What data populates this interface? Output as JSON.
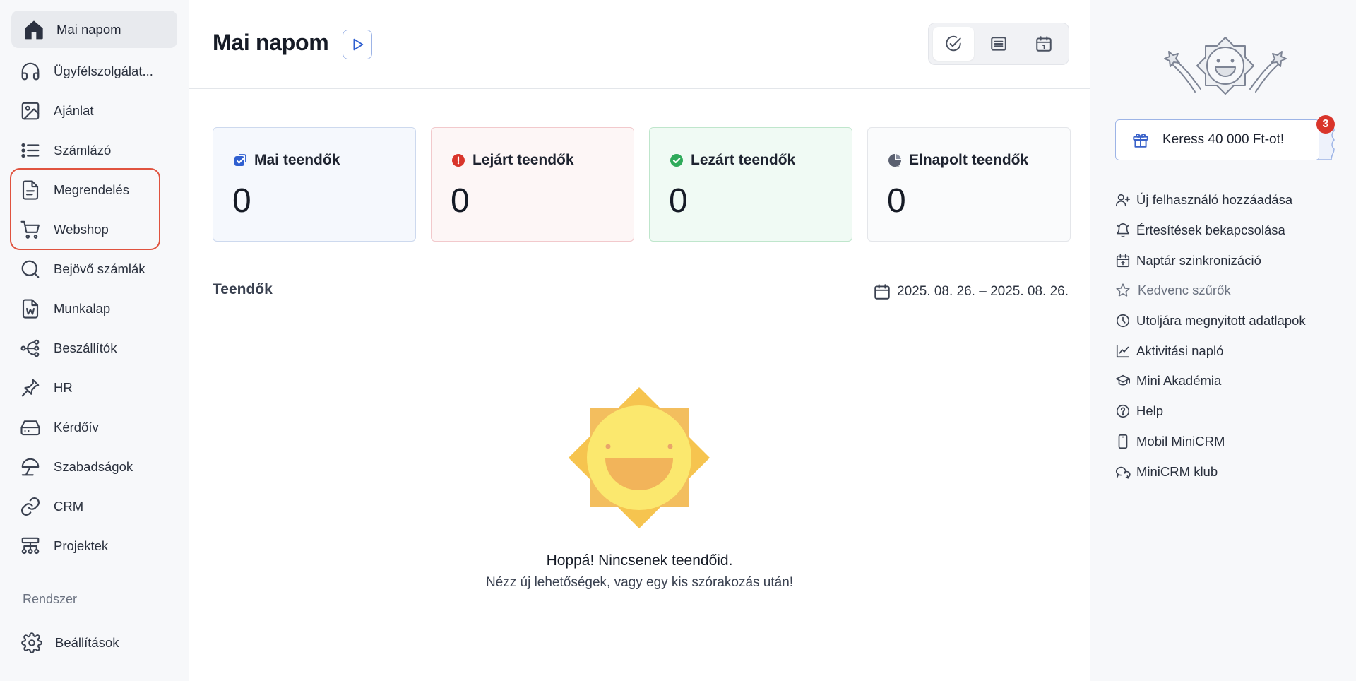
{
  "sidebar": {
    "home": {
      "label": "Mai napom",
      "icon": "home-icon"
    },
    "items": [
      {
        "label": "Ügyfélszolgálat...",
        "icon": "headphones-icon"
      },
      {
        "label": "Ajánlat",
        "icon": "image-icon"
      },
      {
        "label": "Számlázó",
        "icon": "list-icon"
      },
      {
        "label": "Megrendelés",
        "icon": "document-icon"
      },
      {
        "label": "Webshop",
        "icon": "cart-icon"
      },
      {
        "label": "Bejövő számlák",
        "icon": "magnifier-icon"
      },
      {
        "label": "Munkalap",
        "icon": "word-file-icon"
      },
      {
        "label": "Beszállítók",
        "icon": "branch-icon"
      },
      {
        "label": "HR",
        "icon": "pin-icon"
      },
      {
        "label": "Kérdőív",
        "icon": "drive-icon"
      },
      {
        "label": "Szabadságok",
        "icon": "umbrella-icon"
      },
      {
        "label": "CRM",
        "icon": "link-icon"
      },
      {
        "label": "Projektek",
        "icon": "hierarchy-icon"
      }
    ],
    "section_label": "Rendszer",
    "settings": {
      "label": "Beállítások",
      "icon": "gear-icon"
    },
    "highlight_color": "#e0533f"
  },
  "main": {
    "title": "Mai napom",
    "view_toggle": [
      "check-circle-icon",
      "list-view-icon",
      "calendar-icon"
    ],
    "stats": [
      {
        "label": "Mai teendők",
        "value": "0",
        "icon": "checkbox-icon",
        "color": "#2f5fd0"
      },
      {
        "label": "Lejárt teendők",
        "value": "0",
        "icon": "alert-icon",
        "color": "#d9352b"
      },
      {
        "label": "Lezárt teendők",
        "value": "0",
        "icon": "check-icon",
        "color": "#2faa5a"
      },
      {
        "label": "Elnapolt teendők",
        "value": "0",
        "icon": "snooze-icon",
        "color": "#5a6070"
      }
    ],
    "tasks_title": "Teendők",
    "date_range": "2025. 08. 26. – 2025. 08. 26.",
    "empty_title": "Hoppá! Nincsenek teendőid.",
    "empty_subtitle": "Nézz új lehetőségek, vagy egy kis szórakozás után!"
  },
  "right": {
    "gift_label": "Keress 40 000 Ft-ot!",
    "badge_count": "3",
    "quick_links": [
      {
        "label": "Új felhasználó hozzáadása",
        "icon": "user-plus-icon"
      },
      {
        "label": "Értesítések bekapcsolása",
        "icon": "bell-icon"
      },
      {
        "label": "Naptár szinkronizáció",
        "icon": "calendar-sync-icon"
      },
      {
        "label": "Kedvenc szűrők",
        "icon": "star-icon"
      },
      {
        "label": "Utoljára megnyitott adatlapok",
        "icon": "clock-icon"
      },
      {
        "label": "Aktivitási napló",
        "icon": "chart-line-icon"
      },
      {
        "label": "Mini Akadémia",
        "icon": "graduation-cap-icon"
      },
      {
        "label": "Help",
        "icon": "help-circle-icon"
      },
      {
        "label": "Mobil MiniCRM",
        "icon": "mobile-icon"
      },
      {
        "label": "MiniCRM klub",
        "icon": "chat-icon"
      }
    ]
  }
}
